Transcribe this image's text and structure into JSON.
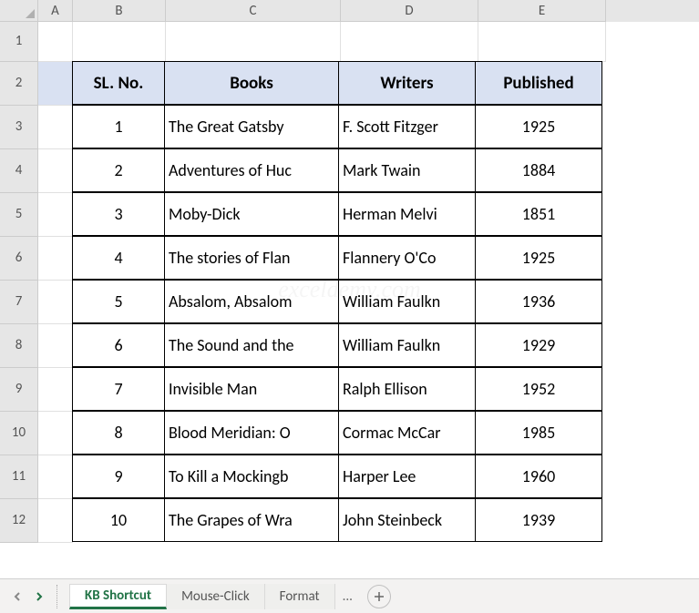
{
  "columns": [
    "A",
    "B",
    "C",
    "D",
    "E"
  ],
  "rows": [
    "1",
    "2",
    "3",
    "4",
    "5",
    "6",
    "7",
    "8",
    "9",
    "10",
    "11",
    "12"
  ],
  "table": {
    "headers": {
      "sl": "SL. No.",
      "books": "Books",
      "writers": "Writers",
      "published": "Published"
    },
    "data": [
      {
        "sl": "1",
        "book": "The Great Gatsby",
        "writer": "F. Scott Fitzger",
        "year": "1925"
      },
      {
        "sl": "2",
        "book": "Adventures of Huc",
        "writer": "Mark Twain",
        "year": "1884"
      },
      {
        "sl": "3",
        "book": "Moby-Dick",
        "writer": "Herman Melvi",
        "year": "1851"
      },
      {
        "sl": "4",
        "book": "The stories of Flan",
        "writer": "Flannery O'Co",
        "year": "1925"
      },
      {
        "sl": "5",
        "book": "Absalom, Absalom",
        "writer": "William Faulkn",
        "year": "1936"
      },
      {
        "sl": "6",
        "book": "The Sound and the",
        "writer": "William Faulkn",
        "year": "1929"
      },
      {
        "sl": "7",
        "book": "Invisible Man",
        "writer": "Ralph Ellison",
        "year": "1952"
      },
      {
        "sl": "8",
        "book": "Blood Meridian: O",
        "writer": "Cormac McCar",
        "year": "1985"
      },
      {
        "sl": "9",
        "book": "To Kill a Mockingb",
        "writer": "Harper Lee",
        "year": "1960"
      },
      {
        "sl": "10",
        "book": "The Grapes of Wra",
        "writer": "John Steinbeck",
        "year": "1939"
      }
    ]
  },
  "tabs": {
    "active": "KB Shortcut",
    "others": [
      "Mouse-Click",
      "Format"
    ],
    "more": "..."
  },
  "watermark": "exceldemy.com"
}
